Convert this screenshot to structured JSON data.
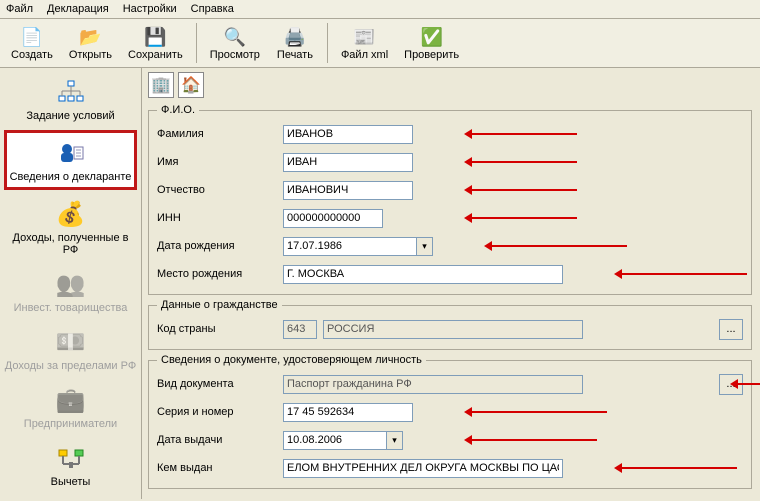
{
  "menu": {
    "file": "Файл",
    "decl": "Декларация",
    "settings": "Настройки",
    "help": "Справка"
  },
  "toolbar": {
    "create": "Создать",
    "open": "Открыть",
    "save": "Сохранить",
    "preview": "Просмотр",
    "print": "Печать",
    "xml": "Файл xml",
    "check": "Проверить"
  },
  "sidebar": {
    "cond": "Задание условий",
    "decl": "Сведения о декларанте",
    "income_rf": "Доходы, полученные в РФ",
    "invest": "Инвест. товарищества",
    "income_foreign": "Доходы за пределами РФ",
    "entrepreneurs": "Предприниматели",
    "deductions": "Вычеты"
  },
  "fio": {
    "legend": "Ф.И.О.",
    "surname_lbl": "Фамилия",
    "surname_val": "ИВАНОВ",
    "name_lbl": "Имя",
    "name_val": "ИВАН",
    "patronymic_lbl": "Отчество",
    "patronymic_val": "ИВАНОВИЧ",
    "inn_lbl": "ИНН",
    "inn_val": "000000000000",
    "dob_lbl": "Дата рождения",
    "dob_val": "17.07.1986",
    "pob_lbl": "Место рождения",
    "pob_val": "Г. МОСКВА"
  },
  "citizen": {
    "legend": "Данные о гражданстве",
    "country_lbl": "Код страны",
    "country_code": "643",
    "country_name": "РОССИЯ"
  },
  "doc": {
    "legend": "Сведения о документе, удостоверяющем личность",
    "type_lbl": "Вид документа",
    "type_val": "Паспорт гражданина РФ",
    "series_lbl": "Серия и номер",
    "series_val": "17 45 592634",
    "issue_date_lbl": "Дата выдачи",
    "issue_date_val": "10.08.2006",
    "issued_by_lbl": "Кем выдан",
    "issued_by_val": "ЕЛОМ ВНУТРЕННИХ ДЕЛ ОКРУГА МОСКВЫ ПО ЦАО"
  },
  "ellipsis": "...",
  "dropdown_glyph": "▾"
}
